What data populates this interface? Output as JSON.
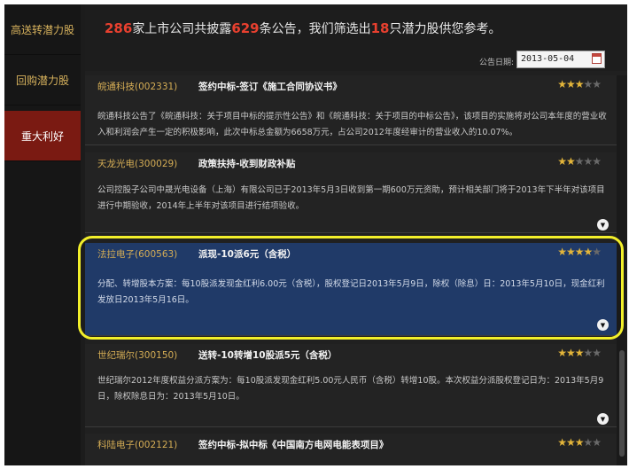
{
  "sidebar": {
    "items": [
      {
        "label": "高送转潜力股"
      },
      {
        "label": "回购潜力股"
      },
      {
        "label": "重大利好"
      }
    ]
  },
  "header": {
    "num1": "286",
    "text1": "家上市公司共披露",
    "num2": "629",
    "text2": "条公告，我们筛选出",
    "num3": "18",
    "text3": "只潜力股供您参考。",
    "date_label": "公告日期:",
    "date_value": "2013-05-04"
  },
  "items": [
    {
      "company": "皖通科技(002331)",
      "headline": "签约中标-签订《施工合同协议书》",
      "stars_on": "★★★",
      "stars_off": "★★",
      "description": "皖通科技公告了《皖通科技：关于项目中标的提示性公告》和《皖通科技：关于项目的中标公告》，该项目的实施将对公司本年度的营业收入和利润会产生一定的积极影响，此次中标总金额为6658万元，占公司2012年度经审计的营业收入的10.07%。"
    },
    {
      "company": "天龙光电(300029)",
      "headline": "政策扶持-收到财政补贴",
      "stars_on": "★★",
      "stars_off": "★★★",
      "description": "公司控股子公司中晟光电设备（上海）有限公司已于2013年5月3日收到第一期600万元资助，预计相关部门将于2013年下半年对该项目进行中期验收，2014年上半年对该项目进行结项验收。"
    },
    {
      "company": "法拉电子(600563)",
      "headline": "派现-10派6元（含税）",
      "stars_on": "★★★★",
      "stars_off": "★",
      "description": "分配、转增股本方案：每10股派发现金红利6.00元（含税），股权登记日2013年5月9日，除权（除息）日：2013年5月10日，现金红利发放日2013年5月16日。"
    },
    {
      "company": "世纪瑞尔(300150)",
      "headline": "送转-10转增10股派5元（含税）",
      "stars_on": "★★★",
      "stars_off": "★★",
      "description": "世纪瑞尔2012年度权益分派方案为：每10股派发现金红利5.00元人民币（含税）转增10股。本次权益分派股权登记日为：2013年5月9日，除权除息日为：2013年5月10日。"
    },
    {
      "company": "科陆电子(002121)",
      "headline": "签约中标-拟中标《中国南方电网电能表项目》",
      "stars_on": "★★★",
      "stars_off": "★★"
    }
  ],
  "colors": {
    "accent_red": "#e8402f",
    "gold": "#d5ad55",
    "highlight_blue": "#203a68",
    "active_tab": "#7a1a12",
    "annotation_yellow": "#f2ef2a"
  },
  "icons": {
    "calendar": "calendar-icon",
    "expand": "chevron-down-circle-icon",
    "star": "star-icon"
  }
}
